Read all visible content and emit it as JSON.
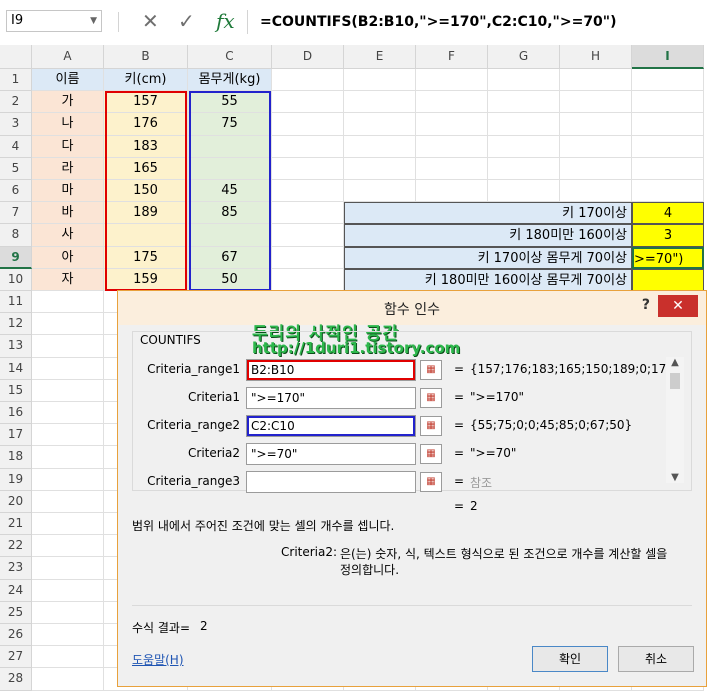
{
  "formula_bar": {
    "name_box": "I9",
    "cancel_icon": "x-icon",
    "enter_icon": "check-icon",
    "fx_label": "fx",
    "formula": "=COUNTIFS(B2:B10,\">=170\",C2:C10,\">=70\")"
  },
  "columns": [
    "A",
    "B",
    "C",
    "D",
    "E",
    "F",
    "G",
    "H",
    "I"
  ],
  "rows": [
    "1",
    "2",
    "3",
    "4",
    "5",
    "6",
    "7",
    "8",
    "9",
    "10",
    "11",
    "12",
    "13",
    "14",
    "15",
    "16",
    "17",
    "18",
    "19",
    "20",
    "21",
    "22",
    "23",
    "24",
    "25",
    "26",
    "27",
    "28"
  ],
  "table": {
    "headers": [
      "이름",
      "키(cm)",
      "몸무게(kg)"
    ],
    "names": [
      "가",
      "나",
      "다",
      "라",
      "마",
      "바",
      "사",
      "아",
      "자"
    ],
    "heights": [
      "157",
      "176",
      "183",
      "165",
      "150",
      "189",
      "",
      "175",
      "159"
    ],
    "weights": [
      "55",
      "75",
      "",
      "",
      "45",
      "85",
      "",
      "67",
      "50"
    ]
  },
  "summary": {
    "labels": [
      "키 170이상",
      "키 180미만 160이상",
      "키 170이상 몸무게 70이상",
      "키 180미만 160이상 몸무게 70이상"
    ],
    "values": [
      "4",
      "3",
      ">=70\")",
      ""
    ]
  },
  "dialog": {
    "title": "함수 인수",
    "help": "?",
    "close": "✕",
    "function_name": "COUNTIFS",
    "watermark_line1": "두리의 사적인 공간",
    "watermark_line2": "http://1duri1.tistory.com",
    "args": [
      {
        "label": "Criteria_range1",
        "value": "B2:B10",
        "result": "{157;176;183;165;150;189;0;17..."
      },
      {
        "label": "Criteria1",
        "value": "\">=170\"",
        "result": "\">=170\""
      },
      {
        "label": "Criteria_range2",
        "value": "C2:C10",
        "result": "{55;75;0;0;45;85;0;67;50}"
      },
      {
        "label": "Criteria2",
        "value": "\">=70\"",
        "result": "\">=70\""
      },
      {
        "label": "Criteria_range3",
        "value": "",
        "result": "참조"
      }
    ],
    "equals": "=",
    "total_result": "2",
    "description": "범위 내에서 주어진 조건에 맞는 셀의 개수를 셉니다.",
    "arg_help_label": "Criteria2:",
    "arg_help_text_line1": "은(는) 숫자, 식, 텍스트 형식으로 된 조건으로 개수를 계산할 셀을",
    "arg_help_text_line2": "정의합니다.",
    "formula_result_label": "수식 결과=",
    "formula_result_value": "2",
    "help_link": "도움말(H)",
    "ok": "확인",
    "cancel": "취소"
  },
  "colors": {
    "accent_red": "#e00000",
    "accent_blue": "#2222cc",
    "excel_green": "#217346",
    "yellow": "#ffff00"
  }
}
